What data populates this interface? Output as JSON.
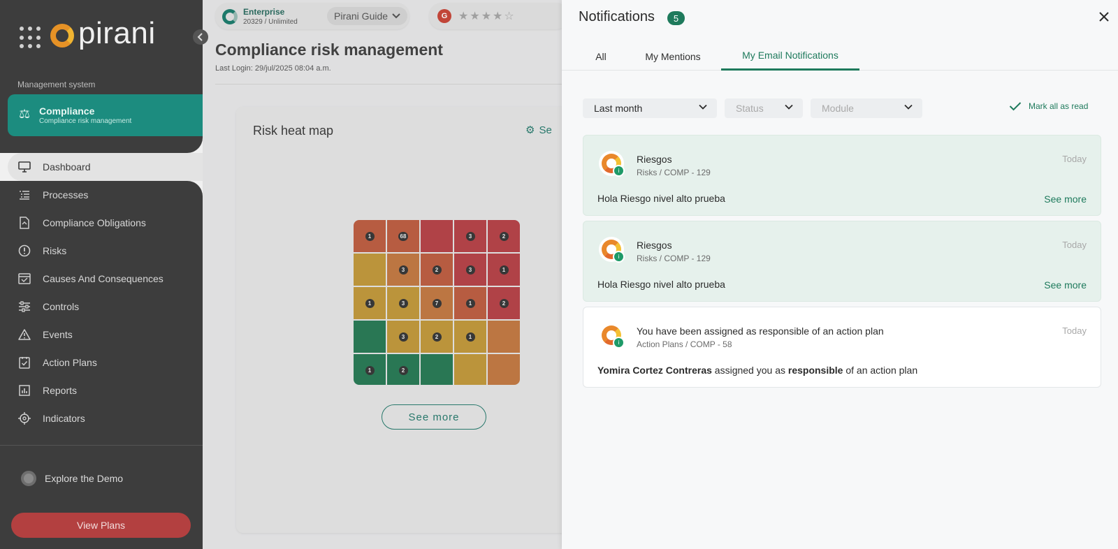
{
  "sidebar": {
    "logo_text": "pirani",
    "system_label": "Management system",
    "module": {
      "title": "Compliance",
      "subtitle": "Compliance risk management"
    },
    "items": [
      {
        "label": "Dashboard",
        "icon": "monitor-icon",
        "active": true
      },
      {
        "label": "Processes",
        "icon": "list-icon"
      },
      {
        "label": "Compliance Obligations",
        "icon": "document-icon"
      },
      {
        "label": "Risks",
        "icon": "alert-circle-icon"
      },
      {
        "label": "Causes And Consequences",
        "icon": "layers-icon"
      },
      {
        "label": "Controls",
        "icon": "sliders-icon"
      },
      {
        "label": "Events",
        "icon": "warning-triangle-icon"
      },
      {
        "label": "Action Plans",
        "icon": "checklist-icon"
      },
      {
        "label": "Reports",
        "icon": "bar-chart-icon"
      },
      {
        "label": "Indicators",
        "icon": "crosshair-icon"
      }
    ],
    "explore_label": "Explore the Demo",
    "view_plans_label": "View Plans"
  },
  "topbar": {
    "plan_name": "Enterprise",
    "plan_quota": "20329 / Unlimited",
    "guide_label": "Pirani Guide",
    "rating_badge": "G",
    "stars": "★★★★☆"
  },
  "page": {
    "title": "Compliance risk management",
    "last_login": "Last Login: 29/jul/2025 08:04 a.m."
  },
  "heatmap_card": {
    "title": "Risk heat map",
    "settings_label": "Se",
    "see_more_label": "See more",
    "rows": [
      [
        {
          "c": "ored",
          "v": "1"
        },
        {
          "c": "ored",
          "v": "68"
        },
        {
          "c": "red",
          "v": ""
        },
        {
          "c": "red",
          "v": "3"
        },
        {
          "c": "red",
          "v": "2"
        }
      ],
      [
        {
          "c": "yellow",
          "v": ""
        },
        {
          "c": "orange",
          "v": "3"
        },
        {
          "c": "ored",
          "v": "2"
        },
        {
          "c": "red",
          "v": "3"
        },
        {
          "c": "red",
          "v": "1"
        }
      ],
      [
        {
          "c": "yellow",
          "v": "1"
        },
        {
          "c": "yellow",
          "v": "3"
        },
        {
          "c": "orange",
          "v": "7"
        },
        {
          "c": "ored",
          "v": "1"
        },
        {
          "c": "red",
          "v": "2"
        }
      ],
      [
        {
          "c": "green",
          "v": ""
        },
        {
          "c": "yellow",
          "v": "3"
        },
        {
          "c": "yellow",
          "v": "2"
        },
        {
          "c": "yellow",
          "v": "1"
        },
        {
          "c": "orange",
          "v": ""
        }
      ],
      [
        {
          "c": "green",
          "v": "1"
        },
        {
          "c": "green",
          "v": "2"
        },
        {
          "c": "green",
          "v": ""
        },
        {
          "c": "yellow",
          "v": ""
        },
        {
          "c": "orange",
          "v": ""
        }
      ]
    ]
  },
  "notifications": {
    "title": "Notifications",
    "count": "5",
    "tabs": [
      {
        "label": "All"
      },
      {
        "label": "My Mentions"
      },
      {
        "label": "My Email Notifications",
        "active": true
      }
    ],
    "filters": {
      "period": "Last month",
      "status_placeholder": "Status",
      "module_placeholder": "Module",
      "mark_all_label": "Mark all as read"
    },
    "items": [
      {
        "title": "Riesgos",
        "path_module": "Risks",
        "path_code": "COMP - 129",
        "time": "Today",
        "body": "Hola Riesgo nivel alto prueba",
        "see_more": "See more",
        "unread": true
      },
      {
        "title": "Riesgos",
        "path_module": "Risks",
        "path_code": "COMP - 129",
        "time": "Today",
        "body": "Hola Riesgo nivel alto prueba",
        "see_more": "See more",
        "unread": true
      },
      {
        "title": "You have been assigned as responsible of an action plan",
        "path_module": "Action Plans",
        "path_code": "COMP - 58",
        "time": "Today",
        "body_actor": "Yomira Cortez Contreras",
        "body_mid": " assigned you as ",
        "body_role": "responsible",
        "body_end": " of an action plan",
        "unread": false
      }
    ]
  },
  "colors": {
    "accent": "#1e7a5c",
    "sidebar_bg": "#3d3d3d",
    "module_bg": "#1c8c7f",
    "view_plans_bg": "#b34040"
  }
}
